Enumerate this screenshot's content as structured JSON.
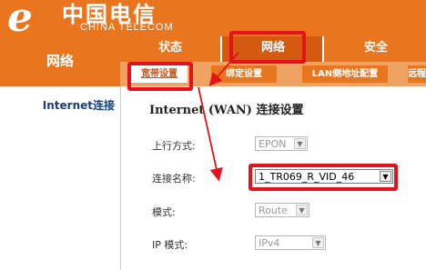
{
  "brand": {
    "logo_cn": "中国电信",
    "logo_en": "CHINA TELECOM",
    "logo_mark": "e"
  },
  "left_panel": {
    "title": "网络"
  },
  "nav": {
    "tabs": [
      {
        "label": "状态",
        "active": false
      },
      {
        "label": "网络",
        "active": true
      },
      {
        "label": "安全",
        "active": false
      }
    ],
    "subtabs": [
      {
        "label": "宽带设置",
        "active": true
      },
      {
        "label": "绑定设置",
        "active": false
      },
      {
        "label": "LAN侧地址配置",
        "active": false
      },
      {
        "label": "远程",
        "active": false
      }
    ]
  },
  "sidebar": {
    "items": [
      {
        "label": "Internet连接"
      }
    ]
  },
  "content": {
    "title": "Internet (WAN) 连接设置",
    "rows": [
      {
        "label": "上行方式:",
        "value": "EPON",
        "enabled": false
      },
      {
        "label": "连接名称:",
        "value": "1_TR069_R_VID_46",
        "enabled": true
      },
      {
        "label": "模式:",
        "value": "Route",
        "enabled": false
      },
      {
        "label": "IP 模式:",
        "value": "IPv4",
        "enabled": false
      }
    ]
  },
  "colors": {
    "accent": "#e9761f",
    "annotation": "#e4121b",
    "sidebar_text": "#1b3f7c"
  }
}
